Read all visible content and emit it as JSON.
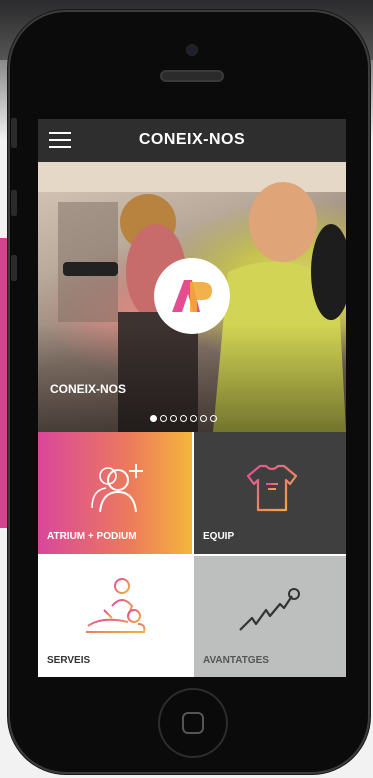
{
  "app": {
    "title": "CONEIX-NOS",
    "menu_icon": "hamburger-icon"
  },
  "hero": {
    "caption": "CONEIX-NOS",
    "logo_text": "AP",
    "slides_total": 7,
    "active_slide": 1
  },
  "tiles": [
    {
      "label": "ATRIUM + PODIUM",
      "icon": "add-user-icon"
    },
    {
      "label": "EQUIP",
      "icon": "tshirt-icon"
    },
    {
      "label": "SERVEIS",
      "icon": "massage-icon"
    },
    {
      "label": "AVANTATGES",
      "icon": "trend-line-icon"
    }
  ],
  "colors": {
    "topbar": "#2e2e2e",
    "brand_pink": "#d9479b",
    "brand_orange": "#f4b63b",
    "tile_dark": "#403f3f",
    "tile_grey": "#bdbebe"
  }
}
